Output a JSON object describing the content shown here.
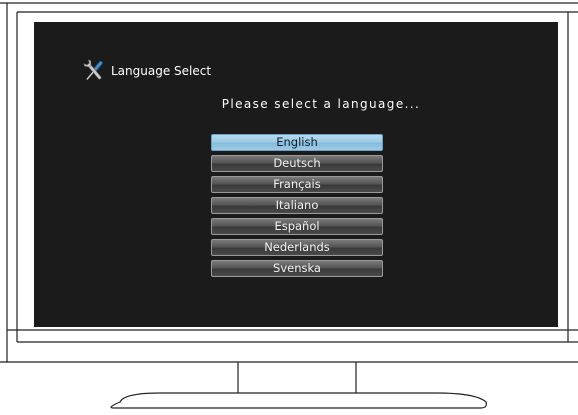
{
  "dialog": {
    "title": "Language Select",
    "title_icon": "wrench-screwdriver-icon",
    "prompt": "Please select a language..."
  },
  "languages": [
    {
      "label": "English",
      "selected": true
    },
    {
      "label": "Deutsch",
      "selected": false
    },
    {
      "label": "Français",
      "selected": false
    },
    {
      "label": "Italiano",
      "selected": false
    },
    {
      "label": "Español",
      "selected": false
    },
    {
      "label": "Nederlands",
      "selected": false
    },
    {
      "label": "Svenska",
      "selected": false
    }
  ],
  "colors": {
    "screen_background": "#1b1b1b",
    "selected_item": "#9ccbe6",
    "unselected_item": "#555555"
  }
}
